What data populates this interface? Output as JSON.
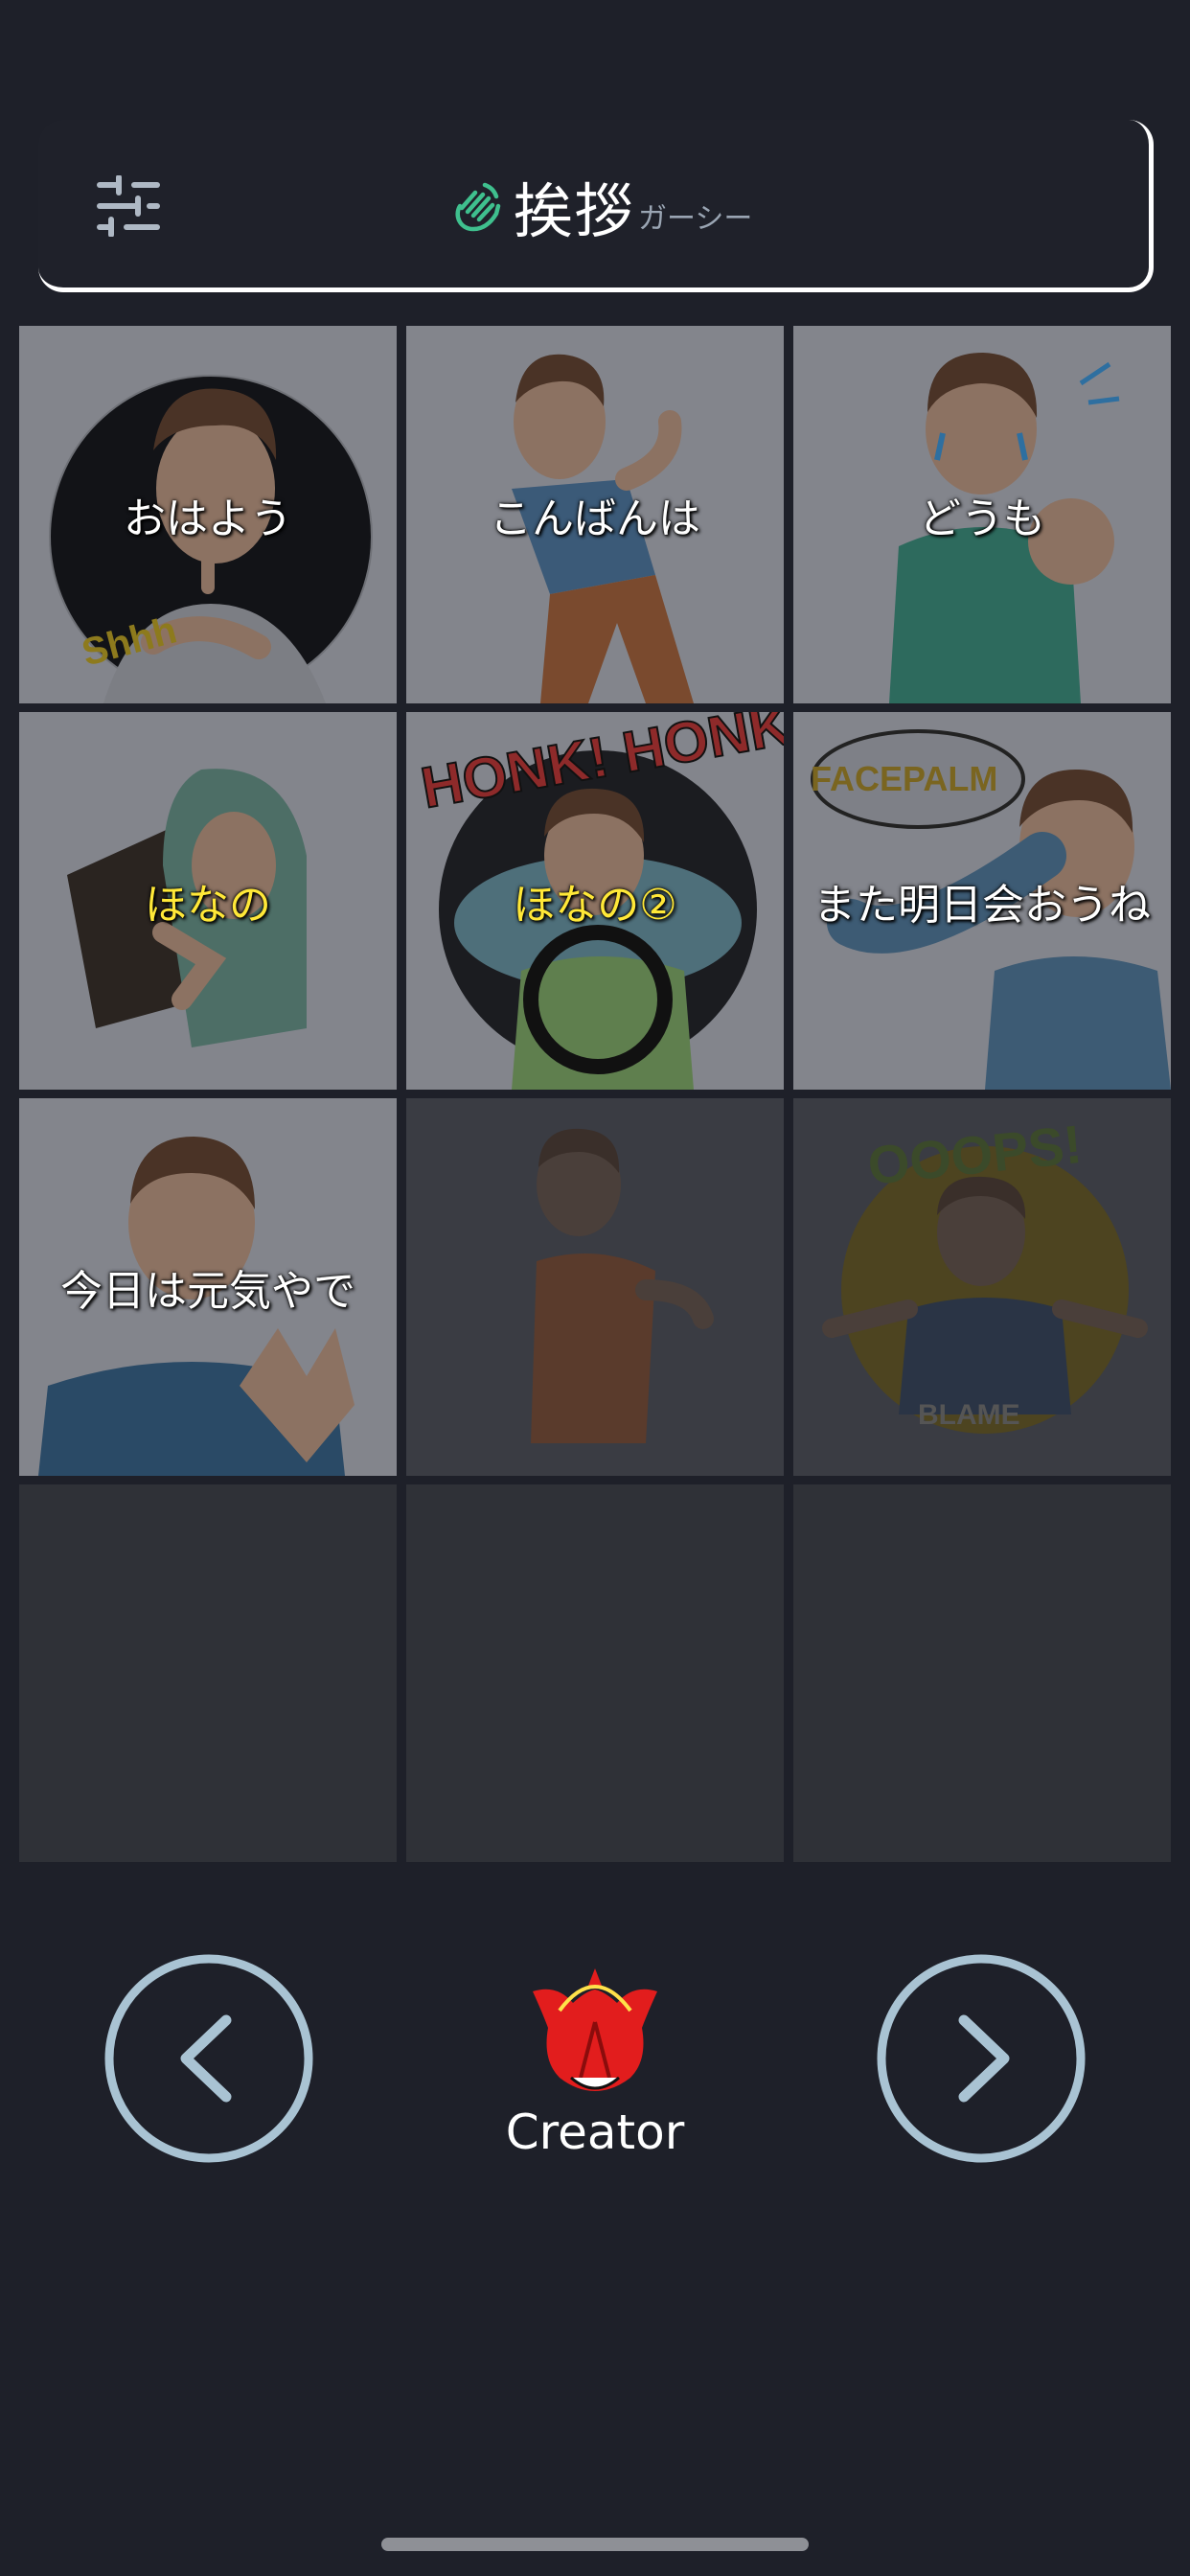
{
  "header": {
    "title": "挨拶",
    "subtitle": "ガーシー",
    "title_icon": "waving-hand-icon",
    "settings_icon": "sliders-icon",
    "accent_color": "#3fc08e"
  },
  "stickers": [
    {
      "label": "おはよう",
      "label_color": "white",
      "state": "active"
    },
    {
      "label": "こんばんは",
      "label_color": "white",
      "state": "active"
    },
    {
      "label": "どうも",
      "label_color": "white",
      "state": "active"
    },
    {
      "label": "ほなの",
      "label_color": "yellow",
      "state": "active"
    },
    {
      "label": "ほなの②",
      "label_color": "yellow",
      "state": "active"
    },
    {
      "label": "また明日会おうね",
      "label_color": "white",
      "state": "active"
    },
    {
      "label": "今日は元気やで",
      "label_color": "white",
      "state": "active"
    },
    {
      "label": "",
      "state": "dimmed"
    },
    {
      "label": "",
      "state": "dimmed"
    },
    {
      "label": "",
      "state": "empty"
    },
    {
      "label": "",
      "state": "empty"
    },
    {
      "label": "",
      "state": "empty"
    }
  ],
  "sticker_art_text": {
    "shh": "Shhh",
    "honk": "HONK! HONK!",
    "facepalm": "FACEPALM",
    "ooops": "OOOPS!",
    "blame": "BLAME"
  },
  "footer": {
    "prev_icon": "chevron-left-icon",
    "next_icon": "chevron-right-icon",
    "creator_label": "Creator",
    "creator_icon": "creator-logo-icon",
    "nav_color": "#a9c3d3"
  }
}
